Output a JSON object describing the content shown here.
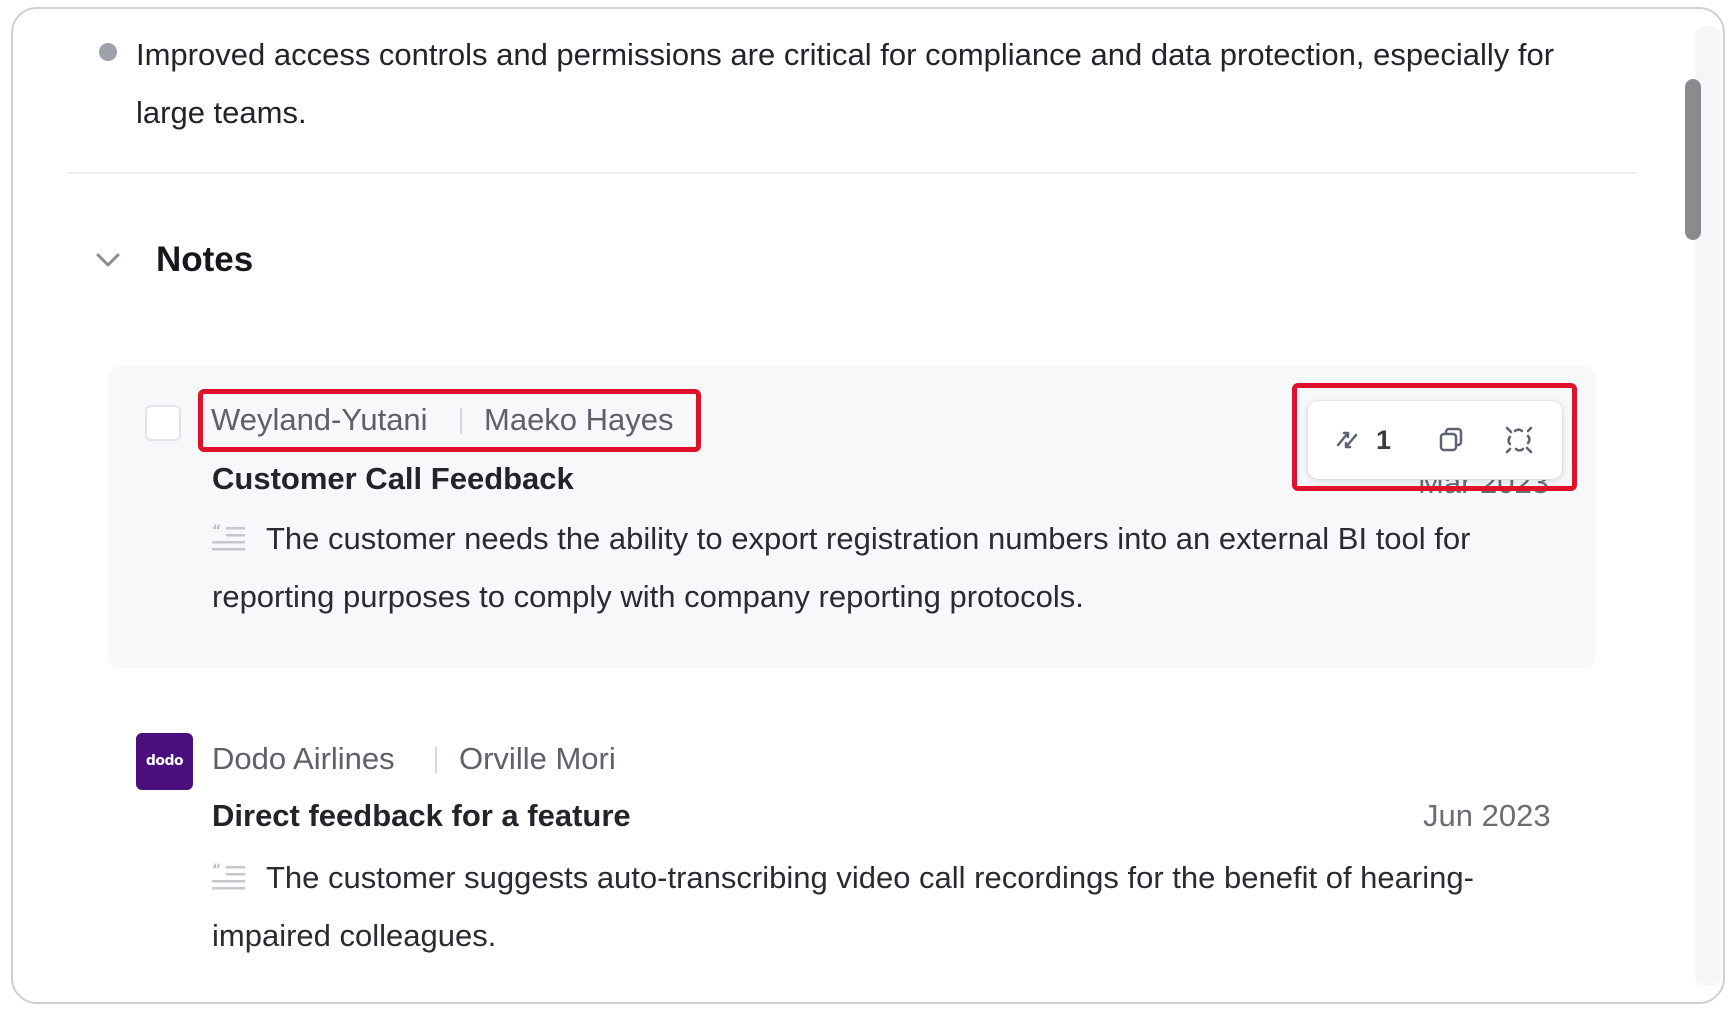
{
  "summary": {
    "bullet_text": "Improved access controls and permissions are critical for compliance and data protection, especially for large teams."
  },
  "notes_section": {
    "title": "Notes"
  },
  "notes": [
    {
      "company": "Weyland-Yutani",
      "person": "Maeko Hayes",
      "title": "Customer Call Feedback",
      "date_partial": "Mar 2023",
      "body": "The customer needs the ability to export registration numbers into an external BI tool for reporting purposes to comply with company reporting protocols.",
      "actions": {
        "link_count": "1",
        "icons": [
          "relink-icon",
          "copy-icon",
          "unlink-icon"
        ]
      }
    },
    {
      "company": "Dodo Airlines",
      "person": "Orville Mori",
      "logo_text": "dodo",
      "title": "Direct feedback for a feature",
      "date": "Jun 2023",
      "body": "The customer suggests auto-transcribing video call recordings for the benefit of hearing-impaired colleagues."
    }
  ],
  "colors": {
    "highlight": "#e0112b",
    "dodo_logo": "#4b0f7d"
  }
}
